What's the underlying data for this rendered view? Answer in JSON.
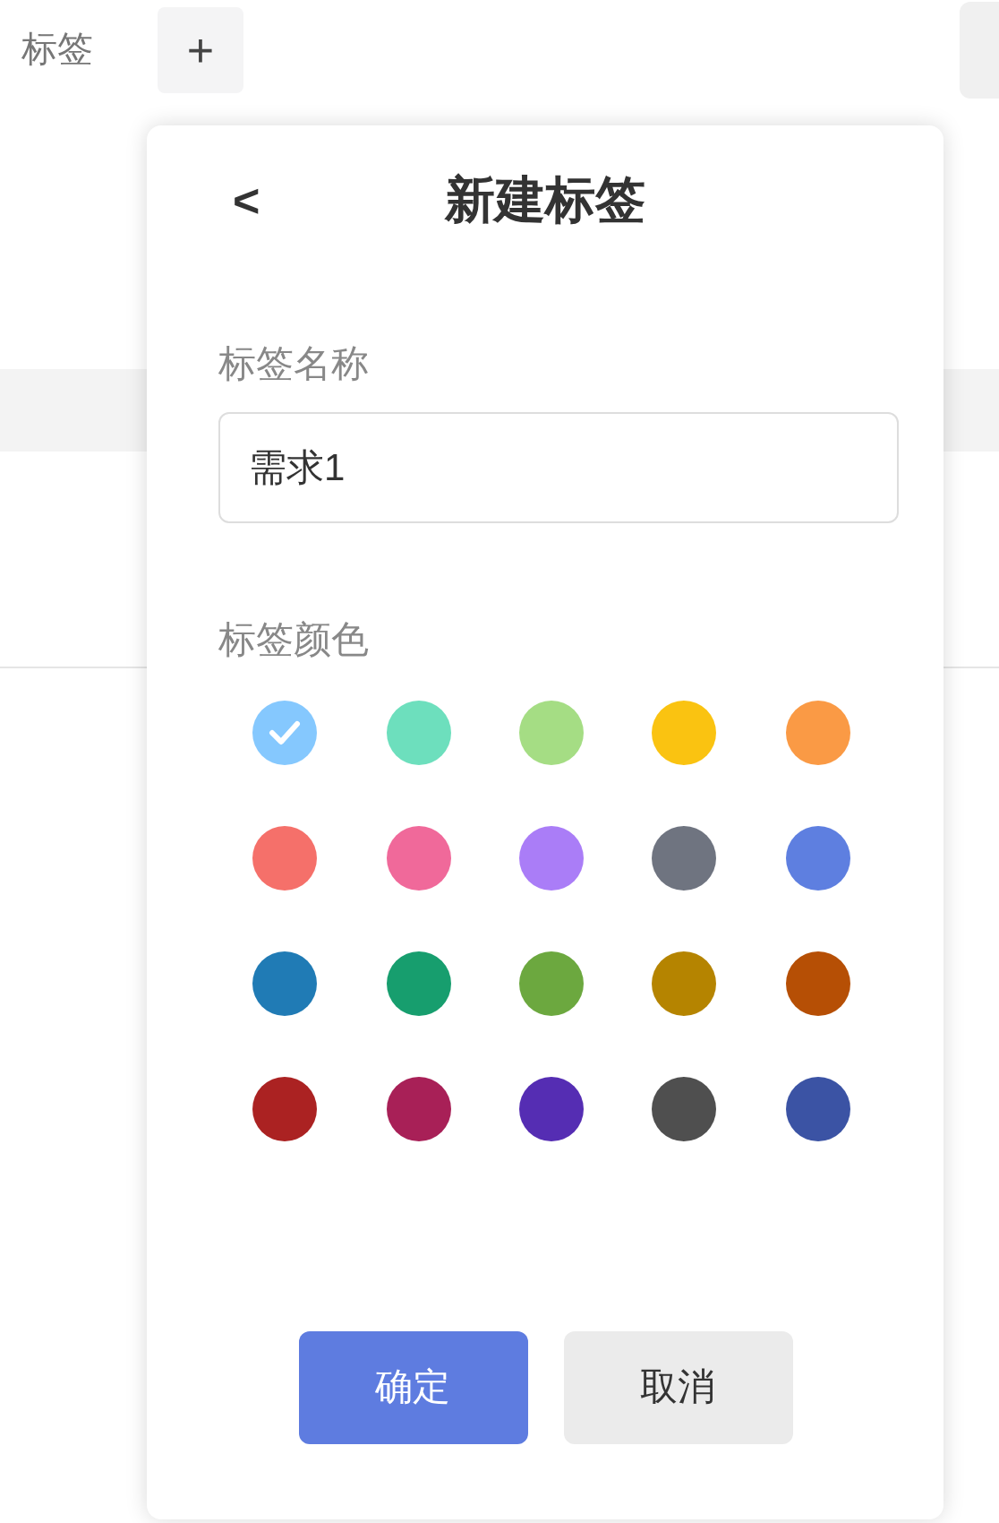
{
  "background": {
    "label": "标签",
    "add_button": "+"
  },
  "popup": {
    "back": "<",
    "title": "新建标签",
    "name_label": "标签名称",
    "name_value": "需求1",
    "color_label": "标签颜色",
    "colors": [
      {
        "color": "#85c8fe",
        "selected": true
      },
      {
        "color": "#6ddfbd",
        "selected": false
      },
      {
        "color": "#a5dd84",
        "selected": false
      },
      {
        "color": "#fac311",
        "selected": false
      },
      {
        "color": "#fa9a45",
        "selected": false
      },
      {
        "color": "#f5706a",
        "selected": false
      },
      {
        "color": "#f0699a",
        "selected": false
      },
      {
        "color": "#aa7df7",
        "selected": false
      },
      {
        "color": "#6f7480",
        "selected": false
      },
      {
        "color": "#5e7fe0",
        "selected": false
      },
      {
        "color": "#207bb5",
        "selected": false
      },
      {
        "color": "#179e6e",
        "selected": false
      },
      {
        "color": "#6ca83f",
        "selected": false
      },
      {
        "color": "#b58400",
        "selected": false
      },
      {
        "color": "#b64f05",
        "selected": false
      },
      {
        "color": "#ab2222",
        "selected": false
      },
      {
        "color": "#a82057",
        "selected": false
      },
      {
        "color": "#552db3",
        "selected": false
      },
      {
        "color": "#4f4f4f",
        "selected": false
      },
      {
        "color": "#3b53a4",
        "selected": false
      }
    ],
    "buttons": [
      {
        "label": "确定",
        "kind": "primary"
      },
      {
        "label": "取消",
        "kind": "secondary"
      }
    ]
  }
}
